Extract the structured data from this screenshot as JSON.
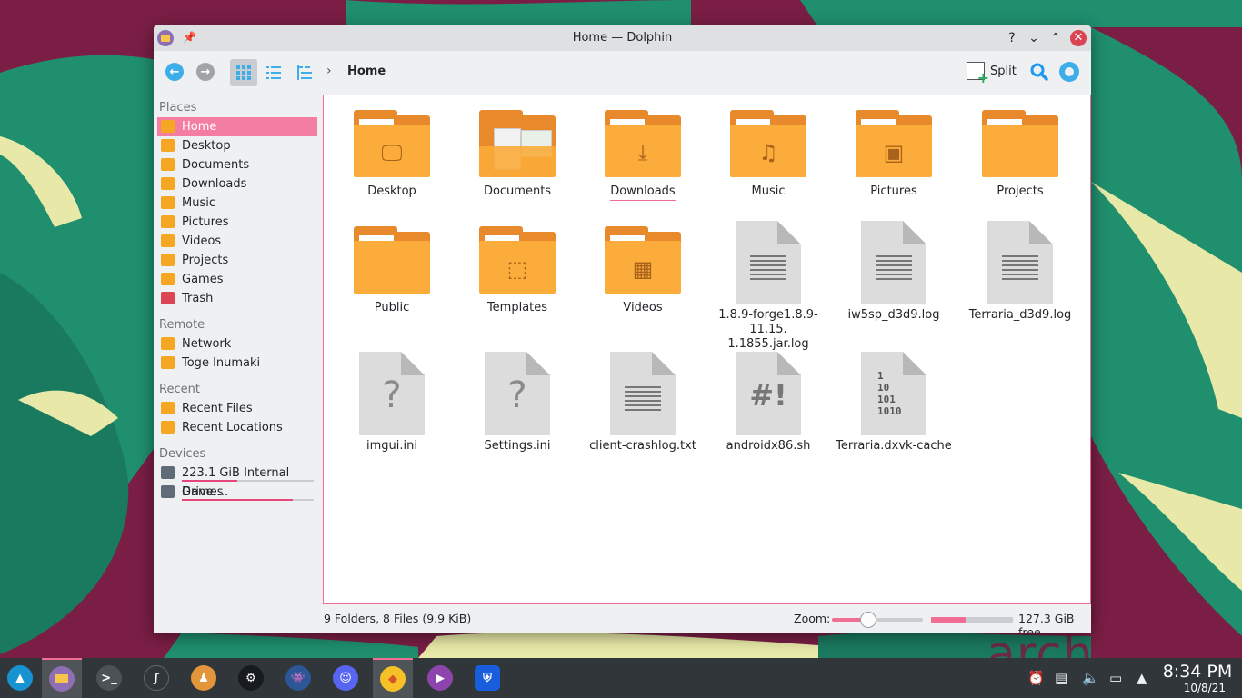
{
  "window": {
    "title": "Home — Dolphin",
    "help_btn": "?",
    "minimize_btn": "⌄",
    "maximize_btn": "⌃",
    "close_btn": "✕"
  },
  "toolbar": {
    "breadcrumb": "Home",
    "split_label": "Split"
  },
  "sidebar": {
    "places_title": "Places",
    "places": [
      {
        "label": "Home"
      },
      {
        "label": "Desktop"
      },
      {
        "label": "Documents"
      },
      {
        "label": "Downloads"
      },
      {
        "label": "Music"
      },
      {
        "label": "Pictures"
      },
      {
        "label": "Videos"
      },
      {
        "label": "Projects"
      },
      {
        "label": "Games"
      },
      {
        "label": "Trash"
      }
    ],
    "remote_title": "Remote",
    "remote": [
      {
        "label": "Network"
      },
      {
        "label": "Toge Inumaki"
      }
    ],
    "recent_title": "Recent",
    "recent": [
      {
        "label": "Recent Files"
      },
      {
        "label": "Recent Locations"
      }
    ],
    "devices_title": "Devices",
    "devices": [
      {
        "label": "223.1 GiB Internal Drive ...",
        "usage": 0.42
      },
      {
        "label": "Games",
        "usage": 0.84
      }
    ]
  },
  "items": [
    {
      "name": "Desktop",
      "kind": "folder",
      "icon": "desktop-folder-icon"
    },
    {
      "name": "Documents",
      "kind": "folder",
      "icon": "documents-folder-icon"
    },
    {
      "name": "Downloads",
      "kind": "folder",
      "icon": "downloads-folder-icon"
    },
    {
      "name": "Music",
      "kind": "folder",
      "icon": "music-folder-icon"
    },
    {
      "name": "Pictures",
      "kind": "folder",
      "icon": "pictures-folder-icon"
    },
    {
      "name": "Projects",
      "kind": "folder",
      "icon": "folder-icon"
    },
    {
      "name": "Public",
      "kind": "folder",
      "icon": "folder-icon"
    },
    {
      "name": "Templates",
      "kind": "folder",
      "icon": "templates-folder-icon"
    },
    {
      "name": "Videos",
      "kind": "folder",
      "icon": "videos-folder-icon"
    },
    {
      "name_line1": "1.8.9-forge1.8.9-11.15.",
      "name_line2": "1.1855.jar.log",
      "kind": "text",
      "icon": "text-file-icon"
    },
    {
      "name": "iw5sp_d3d9.log",
      "kind": "text",
      "icon": "text-file-icon"
    },
    {
      "name": "Terraria_d3d9.log",
      "kind": "text",
      "icon": "text-file-icon"
    },
    {
      "name": "imgui.ini",
      "kind": "unknown",
      "icon": "unknown-file-icon",
      "glyph": "?"
    },
    {
      "name": "Settings.ini",
      "kind": "unknown",
      "icon": "unknown-file-icon",
      "glyph": "?"
    },
    {
      "name": "client-crashlog.txt",
      "kind": "text",
      "icon": "text-file-icon"
    },
    {
      "name": "androidx86.sh",
      "kind": "script",
      "icon": "script-file-icon",
      "glyph": "#!"
    },
    {
      "name": "Terraria.dxvk-cache",
      "kind": "binary",
      "icon": "binary-file-icon",
      "glyph": "1\n10\n101\n1010"
    }
  ],
  "statusbar": {
    "summary": "9 Folders, 8 Files (9.9 KiB)",
    "zoom_label": "Zoom:",
    "zoom_level": 0.4,
    "free_used_fraction": 0.42,
    "free_text": "127.3 GiB free"
  },
  "taskbar": {
    "time": "8:34 PM",
    "date": "10/8/21",
    "apps": [
      "app-launcher-icon",
      "dolphin-icon",
      "konsole-icon",
      "kdenlive-icon",
      "joystick-icon",
      "steam-icon",
      "lutris-icon",
      "discord-icon",
      "brave-icon",
      "media-player-icon",
      "bitwarden-icon"
    ]
  },
  "wallpaper": {
    "logo_text": "archlinux"
  },
  "colors": {
    "accent": "#f06d93",
    "folder": "#fbac3a",
    "wallpaper_bg": "#7a1e45",
    "leaf": "#1f8f6e"
  }
}
